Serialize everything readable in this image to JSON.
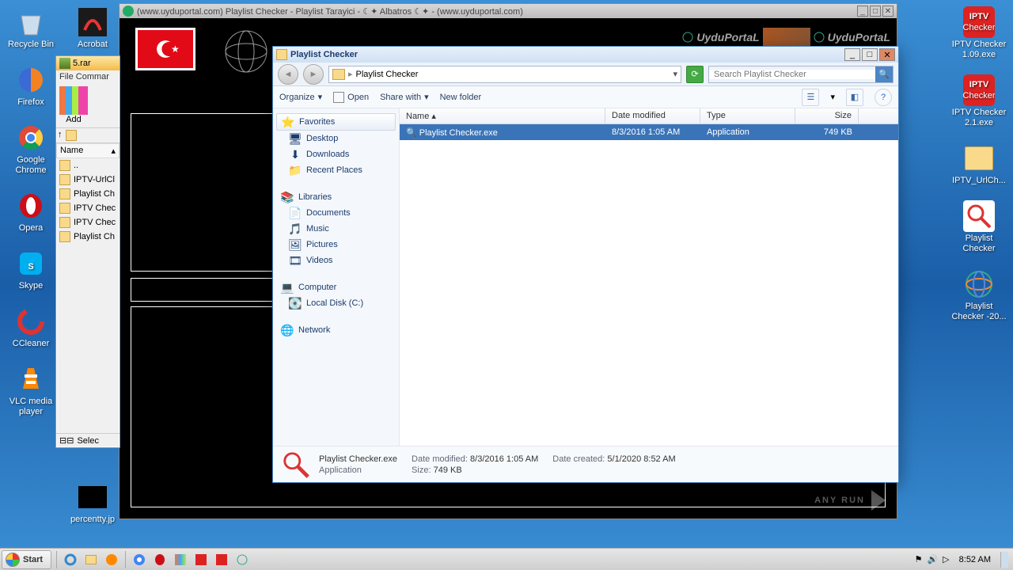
{
  "desktop_left": [
    {
      "label": "Recycle Bin",
      "icon": "recycle"
    },
    {
      "label": "Firefox",
      "icon": "firefox"
    },
    {
      "label": "Google Chrome",
      "icon": "chrome"
    },
    {
      "label": "Opera",
      "icon": "opera"
    },
    {
      "label": "Skype",
      "icon": "skype"
    },
    {
      "label": "CCleaner",
      "icon": "ccleaner"
    },
    {
      "label": "VLC media player",
      "icon": "vlc"
    }
  ],
  "desktop_left2": [
    {
      "label": "Acrobat",
      "icon": "acrobat"
    }
  ],
  "desktop_left2b": [
    {
      "label": "percentty.jp",
      "icon": "black"
    }
  ],
  "desktop_right": [
    {
      "label": "IPTV Checker 1.09.exe",
      "icon": "iptv"
    },
    {
      "label": "IPTV Checker 2.1.exe",
      "icon": "iptv"
    },
    {
      "label": "IPTV_UrlCh...",
      "icon": "folder"
    },
    {
      "label": "Playlist Checker",
      "icon": "magnify"
    },
    {
      "label": "Playlist Checker -20...",
      "icon": "globeC"
    }
  ],
  "bgwin_title": "(www.uyduportal.com) Playlist Checker - Playlist Tarayici -  ☾✦ Albatros ☾✦ - (www.uyduportal.com)",
  "banner_text": "UyduPortaL",
  "rar": {
    "title": "5.rar",
    "menu": "File   Commar",
    "add": "Add",
    "name_hdr": "Name",
    "rows": [
      "..",
      "IPTV-UrlCl",
      "Playlist Ch",
      "IPTV Chec",
      "IPTV Chec",
      "Playlist Ch"
    ],
    "status": "Selec"
  },
  "explorer": {
    "title": "Playlist Checker",
    "path": "Playlist Checker",
    "search_placeholder": "Search Playlist Checker",
    "toolbar": {
      "organize": "Organize",
      "open": "Open",
      "share": "Share with",
      "newfolder": "New folder"
    },
    "side": {
      "favorites": "Favorites",
      "desktop": "Desktop",
      "downloads": "Downloads",
      "recent": "Recent Places",
      "libraries": "Libraries",
      "documents": "Documents",
      "music": "Music",
      "pictures": "Pictures",
      "videos": "Videos",
      "computer": "Computer",
      "localdisk": "Local Disk (C:)",
      "network": "Network"
    },
    "columns": {
      "name": "Name",
      "date": "Date modified",
      "type": "Type",
      "size": "Size"
    },
    "file": {
      "name": "Playlist Checker.exe",
      "date": "8/3/2016 1:05 AM",
      "type": "Application",
      "size": "749 KB"
    },
    "details": {
      "name": "Playlist Checker.exe",
      "type": "Application",
      "modified_k": "Date modified:",
      "modified_v": "8/3/2016 1:05 AM",
      "created_k": "Date created:",
      "created_v": "5/1/2020 8:52 AM",
      "size_k": "Size:",
      "size_v": "749 KB"
    }
  },
  "taskbar": {
    "start": "Start",
    "time": "8:52 AM"
  },
  "watermark": "ANY      RUN"
}
